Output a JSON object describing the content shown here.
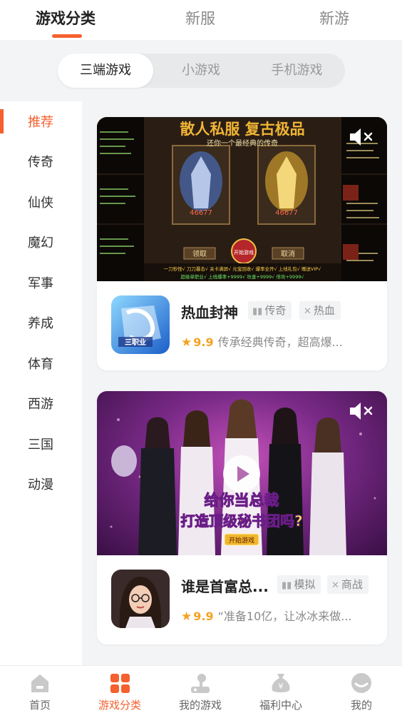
{
  "top_tabs": [
    {
      "label": "游戏分类",
      "active": true
    },
    {
      "label": "新服",
      "active": false
    },
    {
      "label": "新游",
      "active": false
    }
  ],
  "segment": [
    {
      "label": "三端游戏",
      "active": true
    },
    {
      "label": "小游戏",
      "active": false
    },
    {
      "label": "手机游戏",
      "active": false
    }
  ],
  "sidebar": {
    "items": [
      {
        "label": "推荐",
        "active": true
      },
      {
        "label": "传奇"
      },
      {
        "label": "仙侠"
      },
      {
        "label": "魔幻"
      },
      {
        "label": "军事"
      },
      {
        "label": "养成"
      },
      {
        "label": "体育"
      },
      {
        "label": "西游"
      },
      {
        "label": "三国"
      },
      {
        "label": "动漫"
      }
    ]
  },
  "games": [
    {
      "title": "热血封神",
      "tags": [
        {
          "label": "传奇",
          "icon": "book-icon"
        },
        {
          "label": "热血",
          "icon": "swords-icon"
        }
      ],
      "score": "9.9",
      "description": "传承经典传奇，超高爆...",
      "banner": {
        "headline": "散人私服  复古极品",
        "subline": "还你一个最经典的传奇",
        "power_left": "46677",
        "power_right": "46677",
        "btn_left": "领取",
        "btn_center": "开始游戏",
        "btn_right": "取消",
        "features_1": "一刀秒怪√ 刀刀暴击√ 关卡满屏√ 元宝回收√ 爆率全开√ 上线礼包√ 赠送VIP√",
        "features_2": "超级单职业√ 上线爆率+9999√ 攻速+9999√ 倍攻+9999√"
      },
      "icon_text": "三职业"
    },
    {
      "title": "谁是首富总...",
      "tags": [
        {
          "label": "模拟",
          "icon": "book-icon"
        },
        {
          "label": "商战",
          "icon": "swords-icon"
        }
      ],
      "score": "9.9",
      "description": "“准备10亿，让冰冰来做...",
      "banner": {
        "line1": "给你当总裁",
        "line2": "打造顶级秘书团吗?",
        "button": "开始游戏"
      }
    }
  ],
  "bottom_nav": [
    {
      "label": "首页",
      "icon": "home-icon",
      "active": false
    },
    {
      "label": "游戏分类",
      "icon": "grid-icon",
      "active": true
    },
    {
      "label": "我的游戏",
      "icon": "joystick-icon",
      "active": false
    },
    {
      "label": "福利中心",
      "icon": "money-bag-icon",
      "active": false
    },
    {
      "label": "我的",
      "icon": "profile-icon",
      "active": false
    }
  ],
  "colors": {
    "accent": "#f4602f",
    "star": "#f5a223"
  }
}
